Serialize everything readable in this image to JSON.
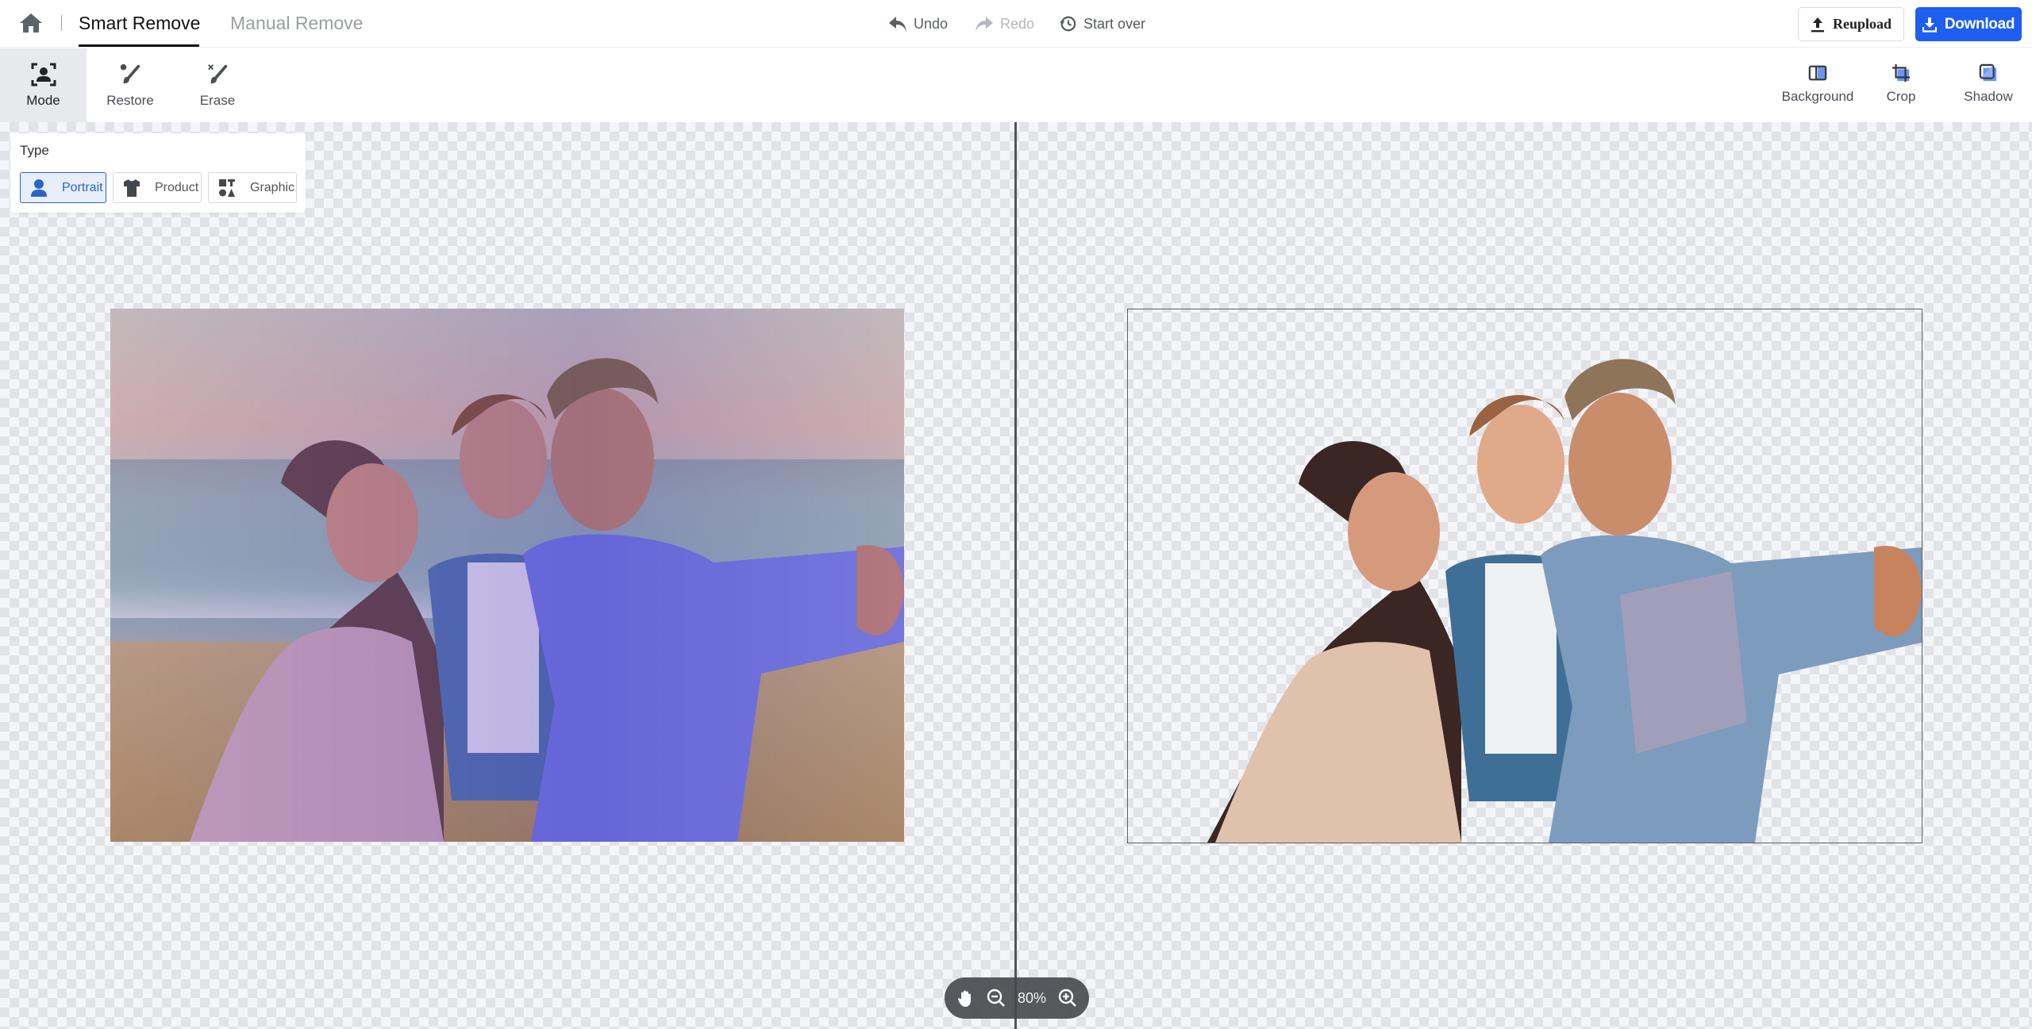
{
  "header": {
    "home_icon": "home-icon",
    "tabs": [
      {
        "label": "Smart Remove",
        "active": true
      },
      {
        "label": "Manual Remove",
        "active": false
      }
    ],
    "history": {
      "undo": "Undo",
      "redo": "Redo",
      "start_over": "Start over"
    },
    "reupload_label": "Reupload",
    "download_label": "Download",
    "accent_color": "#1f5ef0"
  },
  "toolbar": {
    "left_tools": [
      {
        "label": "Mode",
        "icon": "portrait-frame-icon",
        "active": true
      },
      {
        "label": "Restore",
        "icon": "restore-brush-icon",
        "active": false
      },
      {
        "label": "Erase",
        "icon": "erase-brush-icon",
        "active": false
      }
    ],
    "right_tools": [
      {
        "label": "Background",
        "icon": "background-icon"
      },
      {
        "label": "Crop",
        "icon": "crop-icon"
      },
      {
        "label": "Shadow",
        "icon": "shadow-icon"
      }
    ]
  },
  "type_panel": {
    "title": "Type",
    "options": [
      {
        "label": "Portrait",
        "icon": "person-icon",
        "selected": true
      },
      {
        "label": "Product",
        "icon": "tshirt-icon",
        "selected": false
      },
      {
        "label": "Graphic",
        "icon": "shapes-icon",
        "selected": false
      }
    ]
  },
  "canvas": {
    "original_image": "Family selfie on beach at sunset (original)",
    "result_image": "Family selfie with background removed (result)"
  },
  "zoom": {
    "value": "80%",
    "pan_icon": "hand-icon",
    "zoom_out_icon": "zoom-out-icon",
    "zoom_in_icon": "zoom-in-icon"
  }
}
